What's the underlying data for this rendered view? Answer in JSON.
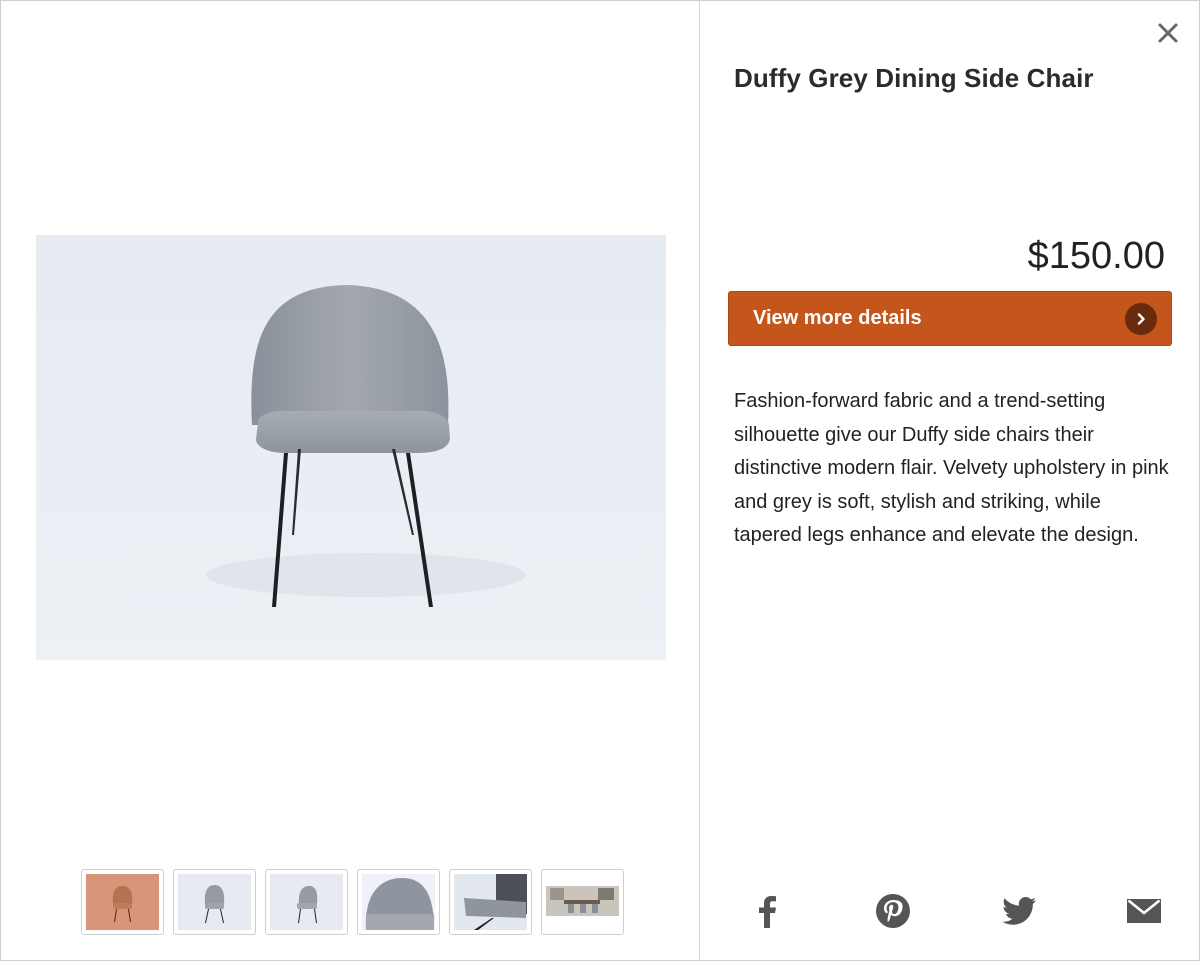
{
  "product": {
    "title": "Duffy Grey Dining Side Chair",
    "price": "$150.00",
    "cta_label": "View more details",
    "description": "Fashion-forward fabric and a trend-setting silhouette give our Duffy side chairs their distinctive modern flair. Velvety upholstery in pink and grey is soft, stylish and striking, while tapered legs enhance and elevate the design."
  },
  "gallery": {
    "thumbnails": [
      {
        "label": "pink chair front",
        "active": true
      },
      {
        "label": "grey chair front",
        "active": false
      },
      {
        "label": "grey chair angle",
        "active": false
      },
      {
        "label": "grey chair back detail",
        "active": false
      },
      {
        "label": "grey chair side detail",
        "active": false
      },
      {
        "label": "dining room scene",
        "active": false
      }
    ]
  },
  "share": {
    "icons": [
      "facebook-icon",
      "pinterest-icon",
      "twitter-icon",
      "email-icon"
    ]
  },
  "colors": {
    "cta": "#c4561b",
    "cta_icon_bg": "#6a2a0e",
    "share_icon": "#555555",
    "pink_chair": "#d9957a"
  }
}
